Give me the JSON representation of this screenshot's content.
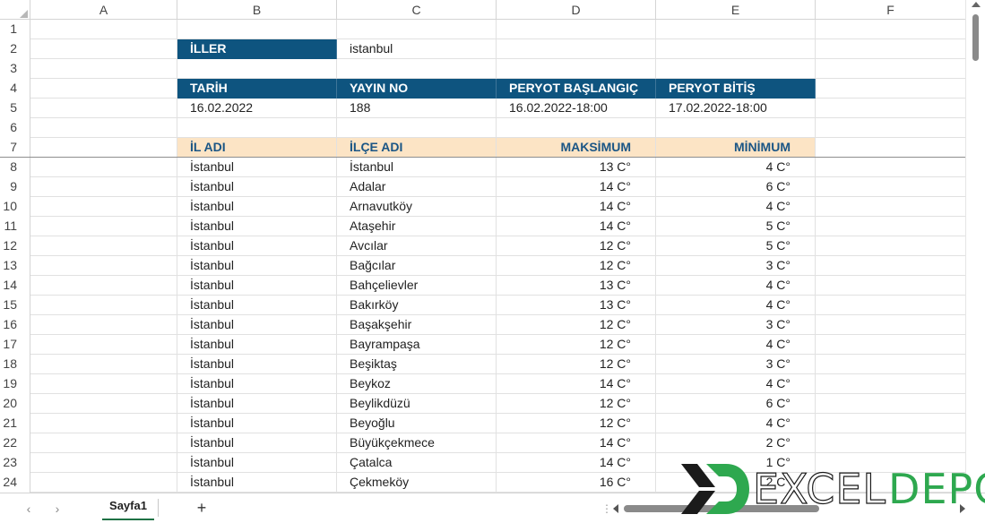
{
  "columns": [
    "A",
    "B",
    "C",
    "D",
    "E",
    "F"
  ],
  "row_numbers": [
    "1",
    "2",
    "3",
    "4",
    "5",
    "6",
    "7",
    "8",
    "9",
    "10",
    "11",
    "12",
    "13",
    "14",
    "15",
    "16",
    "17",
    "18",
    "19",
    "20",
    "21",
    "22",
    "23",
    "24"
  ],
  "cells": {
    "B2": "İLLER",
    "C2": "istanbul",
    "B4": "TARİH",
    "C4": "YAYIN NO",
    "D4": "PERYOT BAŞLANGIÇ",
    "E4": "PERYOT BİTİŞ",
    "B5": "16.02.2022",
    "C5": "188",
    "D5": "16.02.2022-18:00",
    "E5": "17.02.2022-18:00",
    "B7": "İL ADI",
    "C7": "İLÇE ADI",
    "D7": "MAKSİMUM",
    "E7": "MİNİMUM"
  },
  "table_rows": [
    {
      "il": "İstanbul",
      "ilce": "İstanbul",
      "max": "13 C°",
      "min": "4 C°"
    },
    {
      "il": "İstanbul",
      "ilce": "Adalar",
      "max": "14 C°",
      "min": "6 C°"
    },
    {
      "il": "İstanbul",
      "ilce": "Arnavutköy",
      "max": "14 C°",
      "min": "4 C°"
    },
    {
      "il": "İstanbul",
      "ilce": "Ataşehir",
      "max": "14 C°",
      "min": "5 C°"
    },
    {
      "il": "İstanbul",
      "ilce": "Avcılar",
      "max": "12 C°",
      "min": "5 C°"
    },
    {
      "il": "İstanbul",
      "ilce": "Bağcılar",
      "max": "12 C°",
      "min": "3 C°"
    },
    {
      "il": "İstanbul",
      "ilce": "Bahçelievler",
      "max": "13 C°",
      "min": "4 C°"
    },
    {
      "il": "İstanbul",
      "ilce": "Bakırköy",
      "max": "13 C°",
      "min": "4 C°"
    },
    {
      "il": "İstanbul",
      "ilce": "Başakşehir",
      "max": "12 C°",
      "min": "3 C°"
    },
    {
      "il": "İstanbul",
      "ilce": "Bayrampaşa",
      "max": "12 C°",
      "min": "4 C°"
    },
    {
      "il": "İstanbul",
      "ilce": "Beşiktaş",
      "max": "12 C°",
      "min": "3 C°"
    },
    {
      "il": "İstanbul",
      "ilce": "Beykoz",
      "max": "14 C°",
      "min": "4 C°"
    },
    {
      "il": "İstanbul",
      "ilce": "Beylikdüzü",
      "max": "12 C°",
      "min": "6 C°"
    },
    {
      "il": "İstanbul",
      "ilce": "Beyoğlu",
      "max": "12 C°",
      "min": "4 C°"
    },
    {
      "il": "İstanbul",
      "ilce": "Büyükçekmece",
      "max": "14 C°",
      "min": "2 C°"
    },
    {
      "il": "İstanbul",
      "ilce": "Çatalca",
      "max": "14 C°",
      "min": "1 C°"
    },
    {
      "il": "İstanbul",
      "ilce": "Çekmeköy",
      "max": "16 C°",
      "min": "2 C°"
    }
  ],
  "sheet_tabs": [
    "Sayfa1"
  ],
  "bottom_bar": {
    "prev_icon": "chevron-left-icon",
    "next_icon": "chevron-right-icon",
    "add_sheet": "+",
    "dots": "⋮"
  },
  "logo": {
    "text_part1": "EXCEL",
    "text_part2": "DEPO"
  },
  "colors": {
    "header_blue": "#0e547f",
    "header_peach": "#fce4c5",
    "peach_text": "#1a5585",
    "logo_green": "#2ea84f"
  }
}
